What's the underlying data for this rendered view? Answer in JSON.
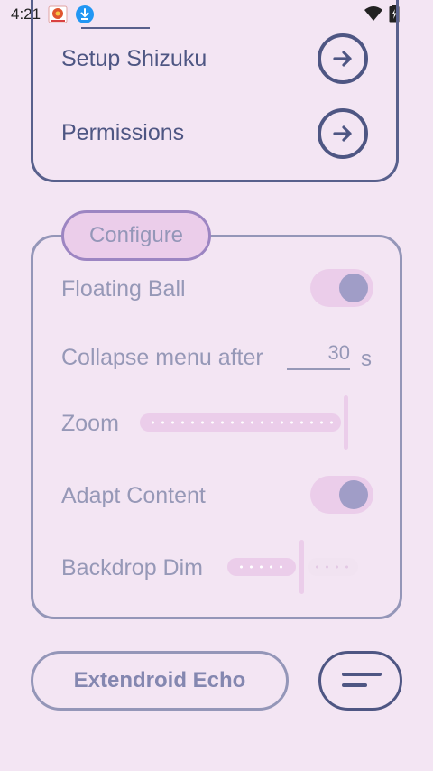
{
  "status_bar": {
    "time": "4:21",
    "icons": [
      "app-notification-icon",
      "download-notification-icon",
      "wifi-icon",
      "battery-icon"
    ]
  },
  "setup": {
    "rows": [
      {
        "label": "Setup Shizuku",
        "icon": "arrow-right-icon"
      },
      {
        "label": "Permissions",
        "icon": "arrow-right-icon"
      }
    ]
  },
  "configure": {
    "title": "Configure",
    "floating_ball": {
      "label": "Floating Ball",
      "enabled": true
    },
    "collapse_menu": {
      "label": "Collapse menu after",
      "value": "30",
      "unit": "s"
    },
    "zoom": {
      "label": "Zoom",
      "level": 1.0
    },
    "adapt_content": {
      "label": "Adapt Content",
      "enabled": true
    },
    "backdrop_dim": {
      "label": "Backdrop Dim",
      "level": 0.55
    }
  },
  "bottom": {
    "app_button_label": "Extendroid Echo",
    "menu_icon": "sort-lines-icon"
  },
  "colors": {
    "background": "#f3e5f3",
    "primary": "#4e5683",
    "disabled_text": "#9698b7",
    "container": "#ebcdea",
    "thumb": "#a09dc7"
  }
}
